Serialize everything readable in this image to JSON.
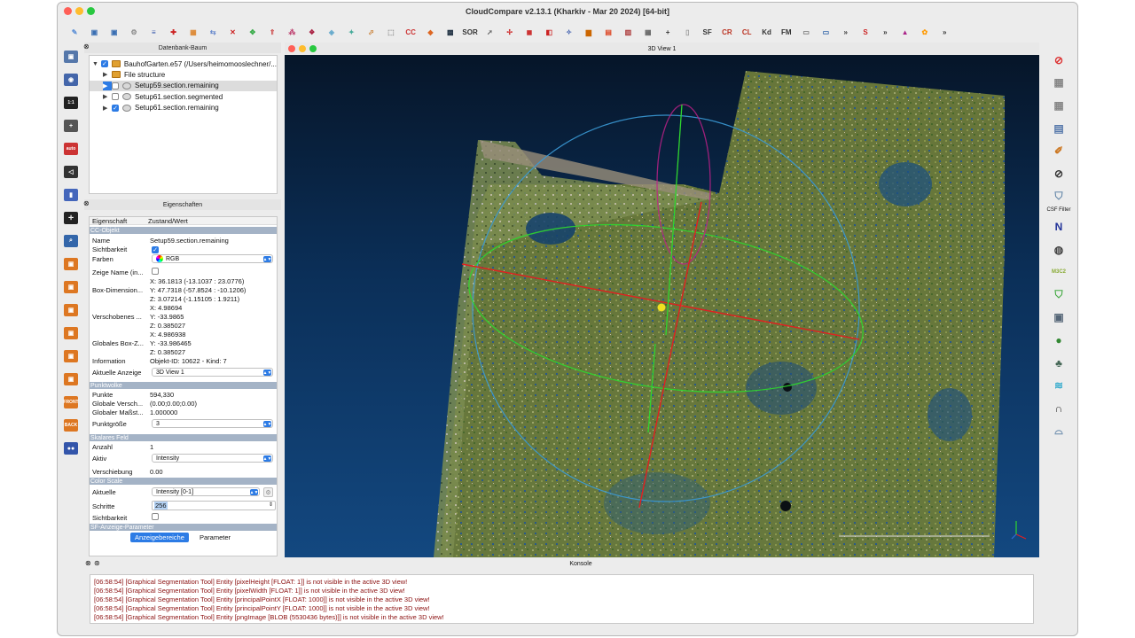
{
  "app": {
    "title": "CloudCompare v2.13.1 (Kharkiv - Mar 20 2024) [64-bit]"
  },
  "toolbar": {
    "buttons": [
      {
        "icon": "pencil-icon",
        "color": "#5b8fd6",
        "glyph": "✎"
      },
      {
        "icon": "save-icon",
        "color": "#3b6fb3",
        "glyph": "▣"
      },
      {
        "icon": "save-all-icon",
        "color": "#3b6fb3",
        "glyph": "▣"
      },
      {
        "icon": "settings-gear-icon",
        "color": "#888888",
        "glyph": "⚙"
      },
      {
        "icon": "list-icon",
        "color": "#3355aa",
        "glyph": "≡"
      },
      {
        "icon": "merge-icon",
        "color": "#cc2222",
        "glyph": "✚"
      },
      {
        "icon": "color-grid-icon",
        "color": "#dd8833",
        "glyph": "▦"
      },
      {
        "icon": "sync-icon",
        "color": "#6688cc",
        "glyph": "⇆"
      },
      {
        "icon": "delete-icon",
        "color": "#cc2222",
        "glyph": "✕"
      },
      {
        "icon": "pick-icon",
        "color": "#33aa44",
        "glyph": "✥"
      },
      {
        "icon": "level-icon",
        "color": "#cc4444",
        "glyph": "⇑"
      },
      {
        "icon": "sample-icon",
        "color": "#bb3366",
        "glyph": "⁂"
      },
      {
        "icon": "noise-icon",
        "color": "#aa2244",
        "glyph": "❖"
      },
      {
        "icon": "subsample-icon",
        "color": "#66aacc",
        "glyph": "◈"
      },
      {
        "icon": "translate-icon",
        "color": "#44aa99",
        "glyph": "✦"
      },
      {
        "icon": "segment-icon",
        "color": "#cc8844",
        "glyph": "⬀"
      },
      {
        "icon": "clean-icon",
        "color": "#888888",
        "glyph": "⬚"
      },
      {
        "icon": "cc-icon",
        "color": "#cc3333",
        "glyph": "CC"
      },
      {
        "icon": "bucket-icon",
        "color": "#dd6622",
        "glyph": "◆"
      },
      {
        "icon": "checker-icon",
        "color": "#223344",
        "glyph": "▩"
      },
      {
        "icon": "sor-icon",
        "color": "#333333",
        "glyph": "SOR"
      },
      {
        "icon": "pointer-icon",
        "color": "#666666",
        "glyph": "➚"
      },
      {
        "icon": "move-icon",
        "color": "#cc2222",
        "glyph": "✢"
      },
      {
        "icon": "cube-icon",
        "color": "#cc3333",
        "glyph": "◼"
      },
      {
        "icon": "box-icon",
        "color": "#cc2222",
        "glyph": "◧"
      },
      {
        "icon": "star-icon",
        "color": "#3355aa",
        "glyph": "✧"
      },
      {
        "icon": "histogram-icon",
        "color": "#cc6600",
        "glyph": "▆"
      },
      {
        "icon": "scalar-icon",
        "color": "#dd4422",
        "glyph": "▤"
      },
      {
        "icon": "bars-icon",
        "color": "#aa3333",
        "glyph": "▥"
      },
      {
        "icon": "table-icon",
        "color": "#666666",
        "glyph": "▦"
      },
      {
        "icon": "plus-icon",
        "color": "#333333",
        "glyph": "+"
      },
      {
        "icon": "file-icon",
        "color": "#999999",
        "glyph": "▯"
      },
      {
        "icon": "sf-icon",
        "color": "#333333",
        "glyph": "SF"
      },
      {
        "icon": "canupo-create-icon",
        "color": "#bb3322",
        "glyph": "CR"
      },
      {
        "icon": "canupo-classify-icon",
        "color": "#bb3322",
        "glyph": "CL"
      },
      {
        "icon": "kd-icon",
        "color": "#333333",
        "glyph": "Kd"
      },
      {
        "icon": "fm-icon",
        "color": "#333333",
        "glyph": "FM"
      },
      {
        "icon": "image-icon",
        "color": "#777777",
        "glyph": "▭"
      },
      {
        "icon": "screen-icon",
        "color": "#3366aa",
        "glyph": "▭"
      },
      {
        "icon": "more-icon",
        "color": "#333333",
        "glyph": "»"
      },
      {
        "icon": "s-curve-icon",
        "color": "#cc2222",
        "glyph": "S"
      },
      {
        "icon": "more2-icon",
        "color": "#333333",
        "glyph": "»"
      },
      {
        "icon": "mountain-icon",
        "color": "#aa2288",
        "glyph": "▲"
      },
      {
        "icon": "plugin-icon",
        "color": "#ff9900",
        "glyph": "✿"
      },
      {
        "icon": "more3-icon",
        "color": "#333333",
        "glyph": "»"
      }
    ]
  },
  "left_tools": [
    {
      "icon": "camera-frame-icon",
      "color": "#5577aa",
      "glyph": "▣"
    },
    {
      "icon": "camera-icon",
      "color": "#4466aa",
      "glyph": "◉"
    },
    {
      "icon": "zoom-1-1-icon",
      "color": "#222222",
      "glyph": "1:1"
    },
    {
      "icon": "add-icon",
      "color": "#555555",
      "glyph": "+"
    },
    {
      "icon": "auto-icon",
      "color": "#cc3333",
      "glyph": "auto"
    },
    {
      "icon": "rotate-icon",
      "color": "#333333",
      "glyph": "◁"
    },
    {
      "icon": "cube-view-icon",
      "color": "#4466bb",
      "glyph": "▮"
    },
    {
      "icon": "crosshair-icon",
      "color": "#222222",
      "glyph": "✛"
    },
    {
      "icon": "magnify-icon",
      "color": "#3366aa",
      "glyph": "⌕"
    },
    {
      "icon": "view-top-icon",
      "color": "#dd7722",
      "glyph": "▣"
    },
    {
      "icon": "view-front-icon",
      "color": "#dd7722",
      "glyph": "▣"
    },
    {
      "icon": "view-left-icon",
      "color": "#dd7722",
      "glyph": "▣"
    },
    {
      "icon": "view-back-icon",
      "color": "#dd7722",
      "glyph": "▣"
    },
    {
      "icon": "view-right-icon",
      "color": "#dd7722",
      "glyph": "▣"
    },
    {
      "icon": "view-bottom-icon",
      "color": "#dd7722",
      "glyph": "▣"
    },
    {
      "icon": "view-iso-front-icon",
      "color": "#dd7722",
      "glyph": "FRONT"
    },
    {
      "icon": "view-iso-back-icon",
      "color": "#dd7722",
      "glyph": "BACK"
    },
    {
      "icon": "stereo-icon",
      "color": "#3355aa",
      "glyph": "●●"
    }
  ],
  "db_tree": {
    "title": "Datenbank-Baum",
    "items": [
      {
        "label": "BauhofGarten.e57 (/Users/heimomooslechner/...",
        "level": 0,
        "expanded": true,
        "checked": true,
        "kind": "folder"
      },
      {
        "label": "File structure",
        "level": 1,
        "expanded": false,
        "checked": null,
        "kind": "folder"
      },
      {
        "label": "Setup59.section.remaining",
        "level": 1,
        "expanded": false,
        "checked": false,
        "kind": "cloud",
        "selected": true
      },
      {
        "label": "Setup61.section.segmented",
        "level": 1,
        "expanded": false,
        "checked": false,
        "kind": "cloud"
      },
      {
        "label": "Setup61.section.remaining",
        "level": 1,
        "expanded": false,
        "checked": true,
        "kind": "cloud"
      }
    ]
  },
  "properties": {
    "title": "Eigenschaften",
    "col_property": "Eigenschaft",
    "col_value": "Zustand/Wert",
    "sections": {
      "cc_object": "CC-Objekt",
      "point_cloud": "Punktwolke",
      "scalar_field": "Skalares Feld",
      "color_scale": "Color Scale",
      "sf_display": "SF-Anzeige-Parameter"
    },
    "name_label": "Name",
    "name_value": "Setup59.section.remaining",
    "visibility_label": "Sichtbarkeit",
    "colors_label": "Farben",
    "colors_value": "RGB",
    "show_name_label": "Zeige Name (in...",
    "box_dim_label": "Box-Dimension...",
    "box_dim_x": "X: 36.1813 (-13.1037 : 23.0776)",
    "box_dim_y": "Y: 47.7318 (-57.8524 : -10.1206)",
    "box_dim_z": "Z: 3.07214 (-1.15105 : 1.9211)",
    "shifted_label": "Verschobenes ...",
    "shifted_x": "X: 4.98694",
    "shifted_y": "Y: -33.9865",
    "shifted_z": "Z: 0.385027",
    "global_box_label": "Globales Box-Z...",
    "global_x": "X: 4.986938",
    "global_y": "Y: -33.986465",
    "global_z": "Z: 0.385027",
    "info_label": "Information",
    "info_value": "Objekt-ID: 10622 - Kind: 7",
    "current_display_label": "Aktuelle Anzeige",
    "current_display_value": "3D View 1",
    "points_label": "Punkte",
    "points_value": "594,330",
    "global_shift_label": "Globale Versch...",
    "global_shift_value": "(0.00;0.00;0.00)",
    "global_scale_label": "Globaler Maßst...",
    "global_scale_value": "1.000000",
    "point_size_label": "Punktgröße",
    "point_size_value": "3",
    "count_label": "Anzahl",
    "count_value": "1",
    "active_label": "Aktiv",
    "active_value": "Intensity",
    "shift_label": "Verschiebung",
    "shift_value": "0.00",
    "current_label": "Aktuelle",
    "current_value": "Intensity [0-1]",
    "steps_label": "Schritte",
    "steps_value": "256",
    "cs_visibility_label": "Sichtbarkeit",
    "tab_ranges": "Anzeigebereiche",
    "tab_params": "Parameter"
  },
  "view": {
    "title": "3D View 1"
  },
  "right_tools": [
    {
      "icon": "stop-icon",
      "color": "#dd3333",
      "glyph": "⊘"
    },
    {
      "icon": "grid-icon",
      "color": "#888888",
      "glyph": "▦"
    },
    {
      "icon": "grid2-icon",
      "color": "#888888",
      "glyph": "▦"
    },
    {
      "icon": "film-icon",
      "color": "#5577aa",
      "glyph": "▤"
    },
    {
      "icon": "brush-icon",
      "color": "#cc7722",
      "glyph": "✐"
    },
    {
      "icon": "compass-icon",
      "color": "#333333",
      "glyph": "⊘"
    },
    {
      "icon": "shield-icon",
      "color": "#6688aa",
      "glyph": "⛉"
    },
    {
      "icon": "north-icon",
      "color": "#223399",
      "glyph": "N"
    },
    {
      "icon": "camera-orbit-icon",
      "color": "#444444",
      "glyph": "◍"
    },
    {
      "icon": "m3c2-icon",
      "color": "#88aa33",
      "glyph": "M3C2"
    },
    {
      "icon": "green-shield-icon",
      "color": "#44aa44",
      "glyph": "⛉"
    },
    {
      "icon": "photo-icon",
      "color": "#556677",
      "glyph": "▣"
    },
    {
      "icon": "green-ball-icon",
      "color": "#338833",
      "glyph": "●"
    },
    {
      "icon": "tree-icon",
      "color": "#446655",
      "glyph": "♣"
    },
    {
      "icon": "layers-icon",
      "color": "#33aacc",
      "glyph": "≋"
    },
    {
      "icon": "headphones-icon",
      "color": "#333333",
      "glyph": "∩"
    },
    {
      "icon": "boat-icon",
      "color": "#6688aa",
      "glyph": "⌓"
    }
  ],
  "csf_filter_label": "CSF Filter",
  "console": {
    "title": "Konsole",
    "lines": [
      "[06:58:54] [Graphical Segmentation Tool] Entity [pixelHeight [FLOAT: 1]] is not visible in the active 3D view!",
      "[06:58:54] [Graphical Segmentation Tool] Entity [pixelWidth [FLOAT: 1]] is not visible in the active 3D view!",
      "[06:58:54] [Graphical Segmentation Tool] Entity [principalPointX [FLOAT: 1000]] is not visible in the active 3D view!",
      "[06:58:54] [Graphical Segmentation Tool] Entity [principalPointY [FLOAT: 1000]] is not visible in the active 3D view!",
      "[06:58:54] [Graphical Segmentation Tool] Entity [pngImage [BLOB (5530436 bytes)]] is not visible in the active 3D view!"
    ]
  }
}
